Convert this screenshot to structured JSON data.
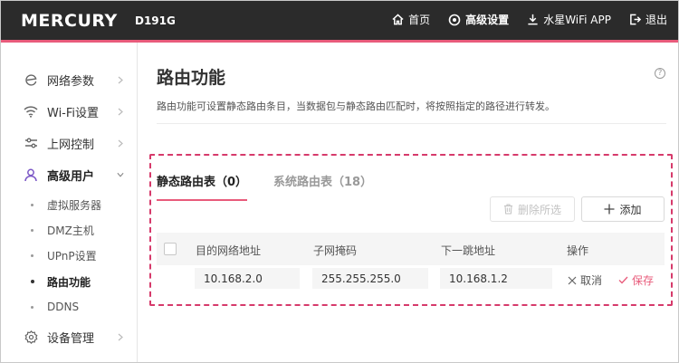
{
  "header": {
    "brand": "MERCURY",
    "model": "D191G",
    "nav": [
      {
        "label": "首页",
        "icon": "home-icon"
      },
      {
        "label": "高级设置",
        "icon": "settings-icon"
      },
      {
        "label": "水星WiFi APP",
        "icon": "download-icon"
      },
      {
        "label": "退出",
        "icon": "logout-icon"
      }
    ],
    "accent_color": "#e85b7b",
    "bg_color": "#2b2b2b"
  },
  "sidebar": {
    "items": [
      {
        "label": "网络参数",
        "icon": "globe-icon"
      },
      {
        "label": "Wi-Fi设置",
        "icon": "wifi-icon"
      },
      {
        "label": "上网控制",
        "icon": "sliders-icon"
      },
      {
        "label": "高级用户",
        "icon": "user-icon"
      },
      {
        "label": "设备管理",
        "icon": "gear-icon"
      }
    ],
    "subitems": [
      {
        "label": "虚拟服务器"
      },
      {
        "label": "DMZ主机"
      },
      {
        "label": "UPnP设置"
      },
      {
        "label": "路由功能"
      },
      {
        "label": "DDNS"
      }
    ],
    "active_subitem": "路由功能"
  },
  "main": {
    "title": "路由功能",
    "help_glyph": "?",
    "description": "路由功能可设置静态路由条目，当数据包与静态路由匹配时，将按照指定的路径进行转发。",
    "tabs": [
      {
        "label": "静态路由表（0）"
      },
      {
        "label": "系统路由表（18）"
      }
    ],
    "buttons": {
      "delete_selected": "删除所选",
      "add": "添加"
    },
    "table": {
      "headers": [
        "目的网络地址",
        "子网掩码",
        "下一跳地址",
        "操作"
      ],
      "row": {
        "destination": "10.168.2.0",
        "netmask": "255.255.255.0",
        "next_hop": "10.168.1.2",
        "cancel": "取消",
        "save": "保存"
      }
    },
    "highlight_color": "#d63a6b"
  }
}
